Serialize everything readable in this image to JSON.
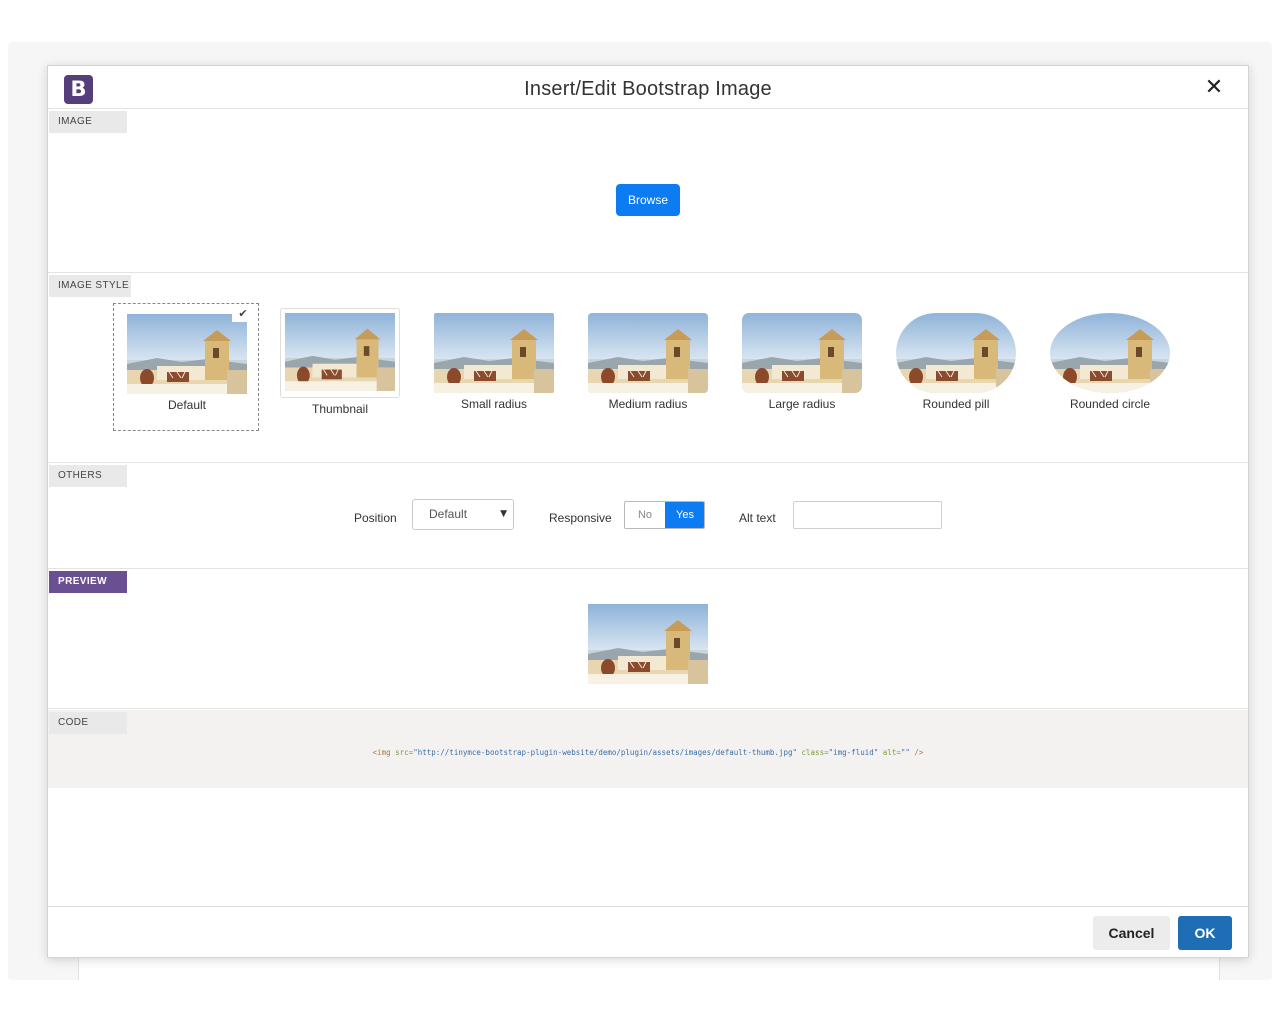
{
  "dialog": {
    "logo_letter": "B",
    "title": "Insert/Edit Bootstrap Image",
    "close_icon": "close-icon"
  },
  "sections": {
    "image": {
      "label": "IMAGE",
      "browse_label": "Browse"
    },
    "image_style": {
      "label": "IMAGE STYLE",
      "check_icon": "✔",
      "options": [
        {
          "label": "Default",
          "selected": true
        },
        {
          "label": "Thumbnail",
          "selected": false
        },
        {
          "label": "Small radius",
          "selected": false
        },
        {
          "label": "Medium radius",
          "selected": false
        },
        {
          "label": "Large radius",
          "selected": false
        },
        {
          "label": "Rounded pill",
          "selected": false
        },
        {
          "label": "Rounded circle",
          "selected": false
        }
      ]
    },
    "others": {
      "label": "OTHERS",
      "position_label": "Position",
      "position_value": "Default",
      "responsive_label": "Responsive",
      "responsive_no": "No",
      "responsive_yes": "Yes",
      "responsive_selected": "Yes",
      "alt_label": "Alt text",
      "alt_value": ""
    },
    "preview": {
      "label": "PREVIEW"
    },
    "code": {
      "label": "CODE",
      "tag_open": "<img",
      "src_attr": "src=",
      "src_value": "\"http://tinymce-bootstrap-plugin-website/demo/plugin/assets/images/default-thumb.jpg\"",
      "class_attr": "class=",
      "class_value": "\"img-fluid\"",
      "alt_attr": "alt=",
      "alt_value": "\"\"",
      "tag_close": "/>"
    }
  },
  "footer": {
    "cancel_label": "Cancel",
    "ok_label": "OK"
  },
  "colors": {
    "brand": "#563d7c",
    "primary": "#0d7cf2",
    "ok": "#1f6db5",
    "active_label": "#6a4f93"
  }
}
